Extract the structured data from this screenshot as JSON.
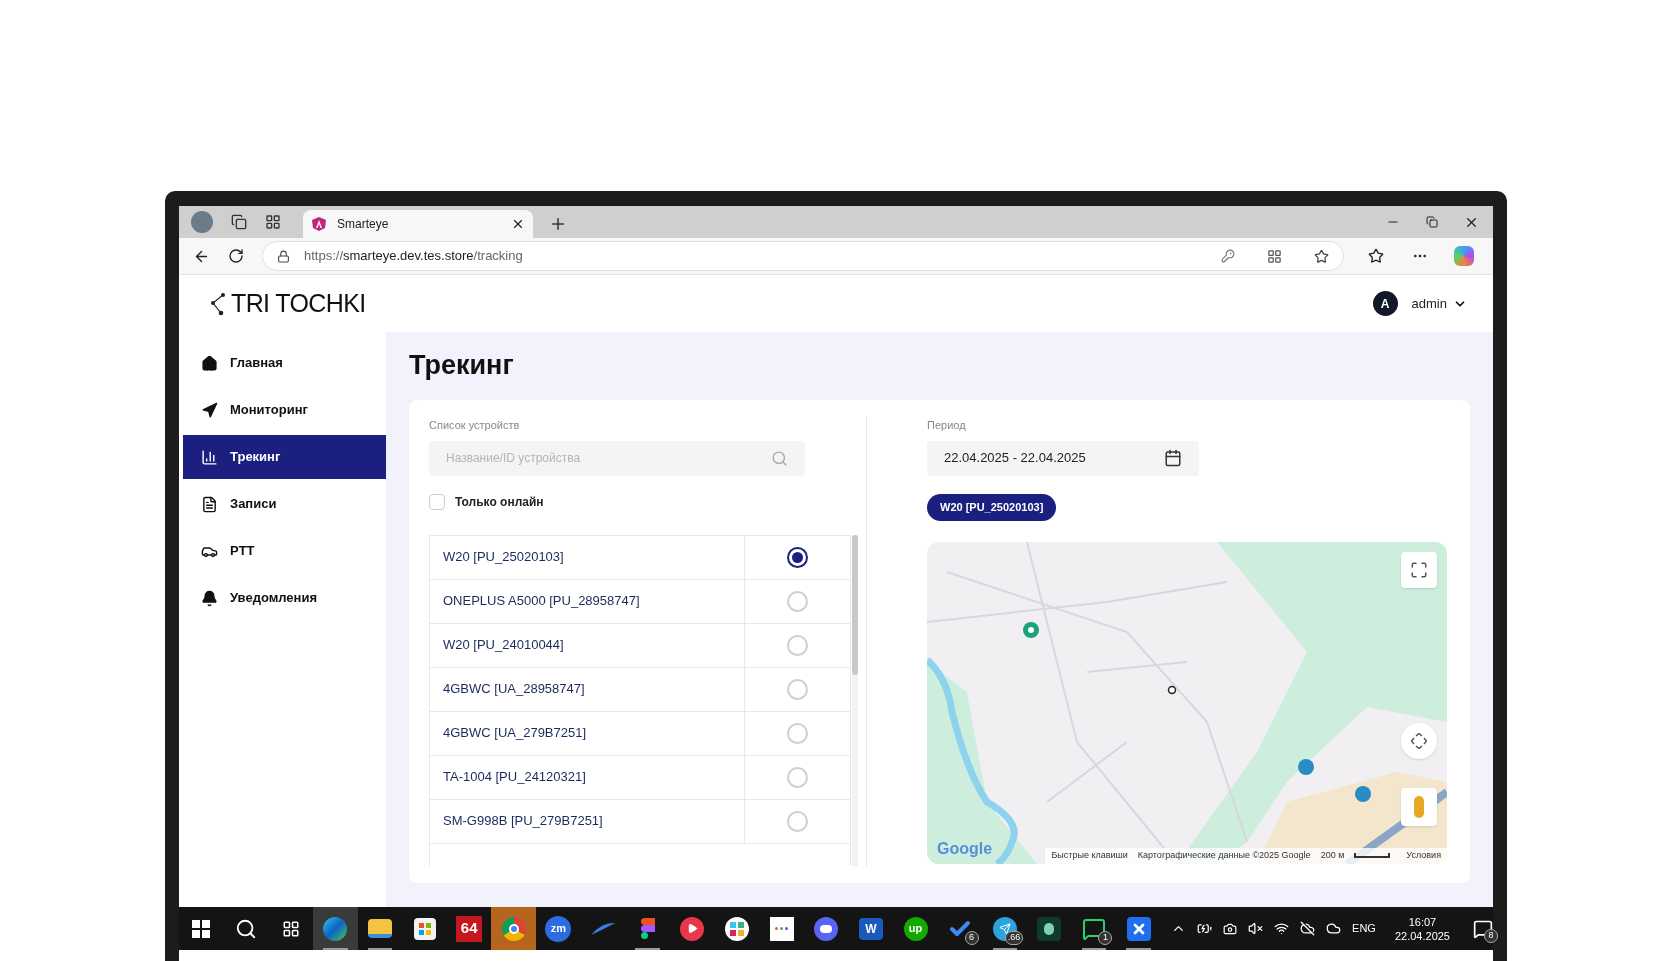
{
  "browser": {
    "tab_title": "Smarteye",
    "url": {
      "scheme": "https://",
      "host": "smarteye.dev.tes.store",
      "path": "/tracking"
    }
  },
  "sidebar": {
    "logo": "TRI TOCHKI",
    "items": [
      {
        "label": "Главная",
        "kind": "home",
        "selected": false
      },
      {
        "label": "Мониторинг",
        "kind": "navigation",
        "selected": false
      },
      {
        "label": "Трекинг",
        "kind": "chart",
        "selected": true
      },
      {
        "label": "Записи",
        "kind": "document",
        "selected": false
      },
      {
        "label": "PTT",
        "kind": "car",
        "selected": false
      },
      {
        "label": "Уведомления",
        "kind": "bell",
        "selected": false
      }
    ]
  },
  "user": {
    "avatar_letter": "A",
    "name": "admin"
  },
  "page_title": "Трекинг",
  "devices": {
    "label": "Список устройств",
    "search": {
      "placeholder": "Название/ID устройства"
    },
    "online_only": {
      "label": "Только онлайн",
      "checked": false
    },
    "rows": [
      {
        "name": "W20 [PU_25020103]",
        "selected": true
      },
      {
        "name": "ONEPLUS A5000 [PU_28958747]",
        "selected": false
      },
      {
        "name": "W20 [PU_24010044]",
        "selected": false
      },
      {
        "name": "4GBWC [UA_28958747]",
        "selected": false
      },
      {
        "name": "4GBWC [UA_279B7251]",
        "selected": false
      },
      {
        "name": "TA-1004 [PU_24120321]",
        "selected": false
      },
      {
        "name": "SM-G998B [PU_279B7251]",
        "selected": false
      }
    ]
  },
  "period": {
    "label": "Период",
    "value": "22.04.2025 - 22.04.2025"
  },
  "chips": [
    "W20 [PU_25020103]"
  ],
  "map": {
    "logo": "Google",
    "shortcuts": "Быстрые клавиши",
    "attribution": "Картографические данные ©2025 Google",
    "scale": "200 м",
    "terms": "Условия"
  },
  "taskbar": {
    "apps": [
      {
        "kind": "start",
        "selected": false,
        "running": false,
        "flashing": false
      },
      {
        "kind": "search",
        "selected": false,
        "running": false,
        "flashing": false
      },
      {
        "kind": "taskview",
        "selected": false,
        "running": false,
        "flashing": false
      },
      {
        "kind": "edge",
        "selected": true,
        "running": true,
        "flashing": false
      },
      {
        "kind": "explorer",
        "selected": false,
        "running": true,
        "flashing": false
      },
      {
        "kind": "store",
        "selected": false,
        "running": false,
        "flashing": false
      },
      {
        "kind": "tile",
        "label": "64",
        "selected": false,
        "running": false,
        "flashing": false
      },
      {
        "kind": "chrome",
        "selected": false,
        "running": false,
        "flashing": true
      },
      {
        "kind": "round",
        "label": "zm",
        "selected": false,
        "running": false,
        "flashing": false
      },
      {
        "kind": "bird",
        "selected": false,
        "running": false,
        "flashing": false
      },
      {
        "kind": "figma",
        "selected": false,
        "running": true,
        "flashing": false
      },
      {
        "kind": "play",
        "selected": false,
        "running": false,
        "flashing": false
      },
      {
        "kind": "slack",
        "selected": false,
        "running": false,
        "flashing": false
      },
      {
        "kind": "dots",
        "selected": false,
        "running": false,
        "flashing": false
      },
      {
        "kind": "discord",
        "selected": false,
        "running": false,
        "flashing": false
      },
      {
        "kind": "word",
        "label": "W",
        "selected": false,
        "running": false,
        "flashing": false
      },
      {
        "kind": "upwork",
        "label": "up",
        "selected": false,
        "running": false,
        "flashing": false
      },
      {
        "kind": "todo",
        "badge": "6",
        "selected": false,
        "running": false,
        "flashing": false
      },
      {
        "kind": "telegram",
        "badge": ".66",
        "selected": false,
        "running": true,
        "flashing": false
      },
      {
        "kind": "darkapp",
        "selected": false,
        "running": false,
        "flashing": false
      },
      {
        "kind": "whatsapp",
        "badge": "1",
        "selected": false,
        "running": true,
        "flashing": false
      },
      {
        "kind": "blueapp",
        "selected": false,
        "running": true,
        "flashing": false
      }
    ],
    "language": "ENG",
    "time": "16:07",
    "date": "22.04.2025",
    "notifications": "8"
  }
}
